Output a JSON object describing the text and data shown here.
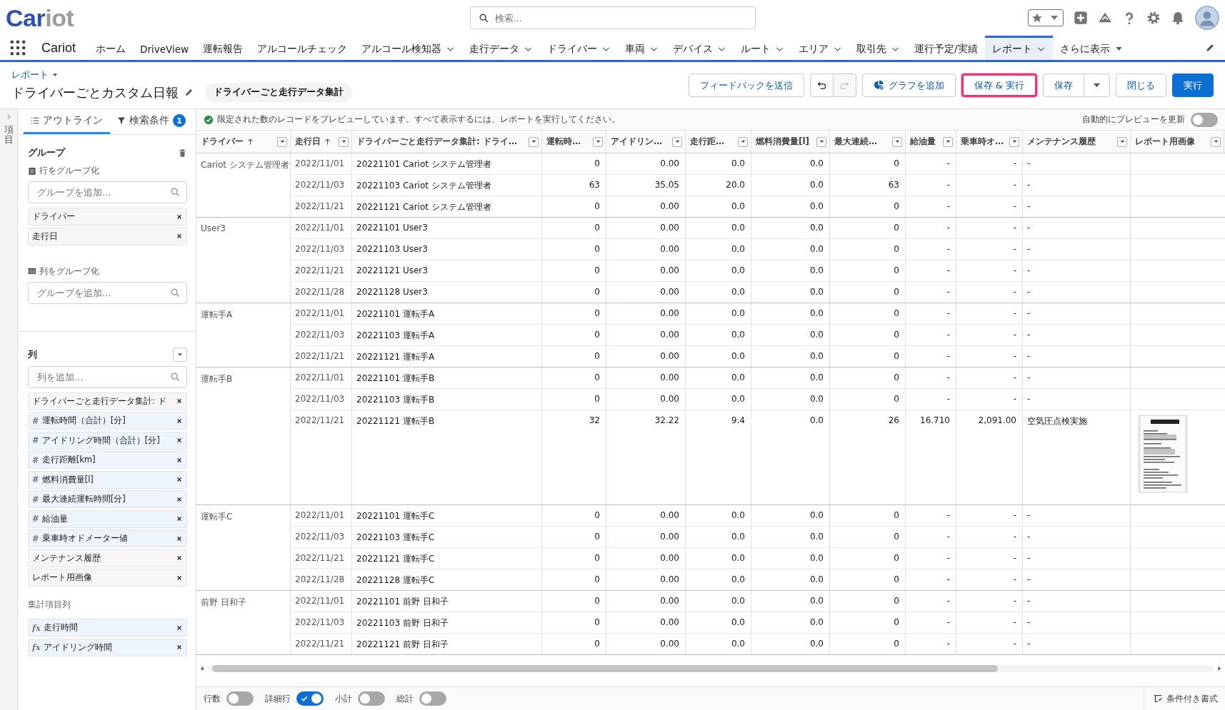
{
  "header": {
    "logo": {
      "primary": "Car",
      "secondary": "iot"
    },
    "search": {
      "placeholder": "検索..."
    }
  },
  "nav": {
    "app_name": "Cariot",
    "items": [
      {
        "label": "ホーム",
        "dropdown": false,
        "selected": false
      },
      {
        "label": "DriveView",
        "dropdown": false,
        "selected": false
      },
      {
        "label": "運転報告",
        "dropdown": false,
        "selected": false
      },
      {
        "label": "アルコールチェック",
        "dropdown": false,
        "selected": false
      },
      {
        "label": "アルコール検知器",
        "dropdown": true,
        "selected": false
      },
      {
        "label": "走行データ",
        "dropdown": true,
        "selected": false
      },
      {
        "label": "ドライバー",
        "dropdown": true,
        "selected": false
      },
      {
        "label": "車両",
        "dropdown": true,
        "selected": false
      },
      {
        "label": "デバイス",
        "dropdown": true,
        "selected": false
      },
      {
        "label": "ルート",
        "dropdown": true,
        "selected": false
      },
      {
        "label": "エリア",
        "dropdown": true,
        "selected": false
      },
      {
        "label": "取引先",
        "dropdown": true,
        "selected": false
      },
      {
        "label": "運行予定/実績",
        "dropdown": false,
        "selected": false
      },
      {
        "label": "レポート",
        "dropdown": true,
        "selected": true
      }
    ],
    "more": {
      "label": "さらに表示"
    }
  },
  "page": {
    "breadcrumb": "レポート",
    "title": "ドライバーごとカスタム日報",
    "report_type": "ドライバーごと走行データ集計",
    "buttons": [
      {
        "kind": "text",
        "label": "フィードバックを送信",
        "disabled": false,
        "highlighted": false
      },
      {
        "kind": "undo",
        "disabled": false,
        "highlighted": false
      },
      {
        "kind": "redo",
        "disabled": true,
        "highlighted": false
      },
      {
        "kind": "chart",
        "label": "グラフを追加",
        "disabled": false,
        "highlighted": false
      },
      {
        "kind": "text",
        "label": "保存 & 実行",
        "disabled": false,
        "highlighted": true
      },
      {
        "kind": "split",
        "label": "保存",
        "disabled": false,
        "highlighted": false
      },
      {
        "kind": "text",
        "label": "閉じる",
        "disabled": false,
        "highlighted": false
      },
      {
        "kind": "primary",
        "label": "実行",
        "disabled": false,
        "highlighted": false
      }
    ]
  },
  "sidebar": {
    "rail_label": "項目",
    "tabs": [
      {
        "label": "アウトライン",
        "selected": true
      },
      {
        "label": "検索条件",
        "selected": false,
        "badge": "1"
      }
    ],
    "groups": {
      "title": "グループ",
      "row_group": {
        "label": "行をグループ化",
        "placeholder": "グループを追加...",
        "chips": [
          "ドライバー",
          "走行日"
        ]
      },
      "column_group": {
        "label": "列をグループ化",
        "placeholder": "グループを追加..."
      }
    },
    "columns": {
      "title": "列",
      "placeholder": "列を追加...",
      "chips": [
        {
          "kind": "text",
          "label": "ドライバーごと走行データ集計: ド"
        },
        {
          "kind": "number",
          "prefix": "#",
          "label": "運転時間（合計）[分]"
        },
        {
          "kind": "number",
          "prefix": "#",
          "label": "アイドリング時間（合計）[分]"
        },
        {
          "kind": "number",
          "prefix": "#",
          "label": "走行距離[km]"
        },
        {
          "kind": "number",
          "prefix": "#",
          "label": "燃料消費量[l]"
        },
        {
          "kind": "number",
          "prefix": "#",
          "label": "最大連続運転時間[分]"
        },
        {
          "kind": "number",
          "prefix": "#",
          "label": "給油量"
        },
        {
          "kind": "number",
          "prefix": "#",
          "label": "乗車時オドメーター値"
        },
        {
          "kind": "text",
          "label": "メンテナンス履歴"
        },
        {
          "kind": "text",
          "label": "レポート用画像"
        }
      ]
    },
    "summary": {
      "title": "集計項目列",
      "chips": [
        {
          "kind": "formula",
          "prefix": "fx",
          "label": "走行時間"
        },
        {
          "kind": "formula",
          "prefix": "fx",
          "label": "アイドリング時間"
        }
      ]
    }
  },
  "preview": {
    "message": "限定された数のレコードをプレビューしています。すべて表示するには、レポートを実行してください。",
    "auto_preview": {
      "label": "自動的にプレビューを更新",
      "on": false
    }
  },
  "table": {
    "columns": [
      {
        "label": "ドライバー",
        "sorted": true,
        "kind": "text"
      },
      {
        "label": "走行日",
        "sorted": true,
        "kind": "text"
      },
      {
        "label": "ドライバーごと走行データ集計: ドライ…",
        "sorted": false,
        "kind": "text"
      },
      {
        "label": "運転時…",
        "sorted": false,
        "kind": "number"
      },
      {
        "label": "アイドリン…",
        "sorted": false,
        "kind": "number"
      },
      {
        "label": "走行距…",
        "sorted": false,
        "kind": "number"
      },
      {
        "label": "燃料消費量[l]",
        "sorted": false,
        "kind": "number"
      },
      {
        "label": "最大連続…",
        "sorted": false,
        "kind": "number"
      },
      {
        "label": "給油量",
        "sorted": false,
        "kind": "number"
      },
      {
        "label": "乗車時オ…",
        "sorted": false,
        "kind": "number"
      },
      {
        "label": "メンテナンス履歴",
        "sorted": false,
        "kind": "text"
      },
      {
        "label": "レポート用画像",
        "sorted": false,
        "kind": "text"
      }
    ],
    "groups": [
      {
        "driver": "Cariot システム管理者",
        "rows": [
          {
            "date": "2022/11/01",
            "cells": [
              "20221101 Cariot システム管理者",
              "0",
              "0.00",
              "0.0",
              "0.0",
              "0",
              "-",
              "-",
              "-"
            ]
          },
          {
            "date": "2022/11/03",
            "cells": [
              "20221103 Cariot システム管理者",
              "63",
              "35.05",
              "20.0",
              "0.0",
              "63",
              "-",
              "-",
              "-"
            ]
          },
          {
            "date": "2022/11/21",
            "cells": [
              "20221121 Cariot システム管理者",
              "0",
              "0.00",
              "0.0",
              "0.0",
              "0",
              "-",
              "-",
              "-"
            ]
          }
        ]
      },
      {
        "driver": "User3",
        "rows": [
          {
            "date": "2022/11/01",
            "cells": [
              "20221101 User3",
              "0",
              "0.00",
              "0.0",
              "0.0",
              "0",
              "-",
              "-",
              "-"
            ]
          },
          {
            "date": "2022/11/03",
            "cells": [
              "20221103 User3",
              "0",
              "0.00",
              "0.0",
              "0.0",
              "0",
              "-",
              "-",
              "-"
            ]
          },
          {
            "date": "2022/11/21",
            "cells": [
              "20221121 User3",
              "0",
              "0.00",
              "0.0",
              "0.0",
              "0",
              "-",
              "-",
              "-"
            ]
          },
          {
            "date": "2022/11/28",
            "cells": [
              "20221128 User3",
              "0",
              "0.00",
              "0.0",
              "0.0",
              "0",
              "-",
              "-",
              "-"
            ]
          }
        ]
      },
      {
        "driver": "運転手A",
        "rows": [
          {
            "date": "2022/11/01",
            "cells": [
              "20221101 運転手A",
              "0",
              "0.00",
              "0.0",
              "0.0",
              "0",
              "-",
              "-",
              "-"
            ]
          },
          {
            "date": "2022/11/03",
            "cells": [
              "20221103 運転手A",
              "0",
              "0.00",
              "0.0",
              "0.0",
              "0",
              "-",
              "-",
              "-"
            ]
          },
          {
            "date": "2022/11/21",
            "cells": [
              "20221121 運転手A",
              "0",
              "0.00",
              "0.0",
              "0.0",
              "0",
              "-",
              "-",
              "-"
            ]
          }
        ]
      },
      {
        "driver": "運転手B",
        "rows": [
          {
            "date": "2022/11/01",
            "cells": [
              "20221101 運転手B",
              "0",
              "0.00",
              "0.0",
              "0.0",
              "0",
              "-",
              "-",
              "-"
            ]
          },
          {
            "date": "2022/11/03",
            "cells": [
              "20221103 運転手B",
              "0",
              "0.00",
              "0.0",
              "0.0",
              "0",
              "-",
              "-",
              "-"
            ]
          },
          {
            "date": "2022/11/21",
            "cells": [
              "20221121 運転手B",
              "32",
              "32.22",
              "9.4",
              "0.0",
              "26",
              "16.710",
              "2,091.00",
              "空気圧点検実施"
            ],
            "image": {
              "kind": "picture"
            }
          }
        ]
      },
      {
        "driver": "運転手C",
        "rows": [
          {
            "date": "2022/11/01",
            "cells": [
              "20221101 運転手C",
              "0",
              "0.00",
              "0.0",
              "0.0",
              "0",
              "-",
              "-",
              "-"
            ]
          },
          {
            "date": "2022/11/03",
            "cells": [
              "20221103 運転手C",
              "0",
              "0.00",
              "0.0",
              "0.0",
              "0",
              "-",
              "-",
              "-"
            ]
          },
          {
            "date": "2022/11/21",
            "cells": [
              "20221121 運転手C",
              "0",
              "0.00",
              "0.0",
              "0.0",
              "0",
              "-",
              "-",
              "-"
            ]
          },
          {
            "date": "2022/11/28",
            "cells": [
              "20221128 運転手C",
              "0",
              "0.00",
              "0.0",
              "0.0",
              "0",
              "-",
              "-",
              "-"
            ]
          }
        ]
      },
      {
        "driver": "前野 日和子",
        "rows": [
          {
            "date": "2022/11/01",
            "cells": [
              "20221101 前野 日和子",
              "0",
              "0.00",
              "0.0",
              "0.0",
              "0",
              "-",
              "-",
              "-"
            ]
          },
          {
            "date": "2022/11/03",
            "cells": [
              "20221103 前野 日和子",
              "0",
              "0.00",
              "0.0",
              "0.0",
              "0",
              "-",
              "-",
              "-"
            ]
          },
          {
            "date": "2022/11/21",
            "cells": [
              "20221121 前野 日和子",
              "0",
              "0.00",
              "0.0",
              "0.0",
              "0",
              "-",
              "-",
              "-"
            ]
          }
        ]
      }
    ]
  },
  "footer": {
    "toggles": [
      {
        "label": "行数",
        "on": false
      },
      {
        "label": "詳細行",
        "on": true
      },
      {
        "label": "小計",
        "on": false
      },
      {
        "label": "総計",
        "on": false
      }
    ],
    "conditional_format": "条件付き書式"
  }
}
